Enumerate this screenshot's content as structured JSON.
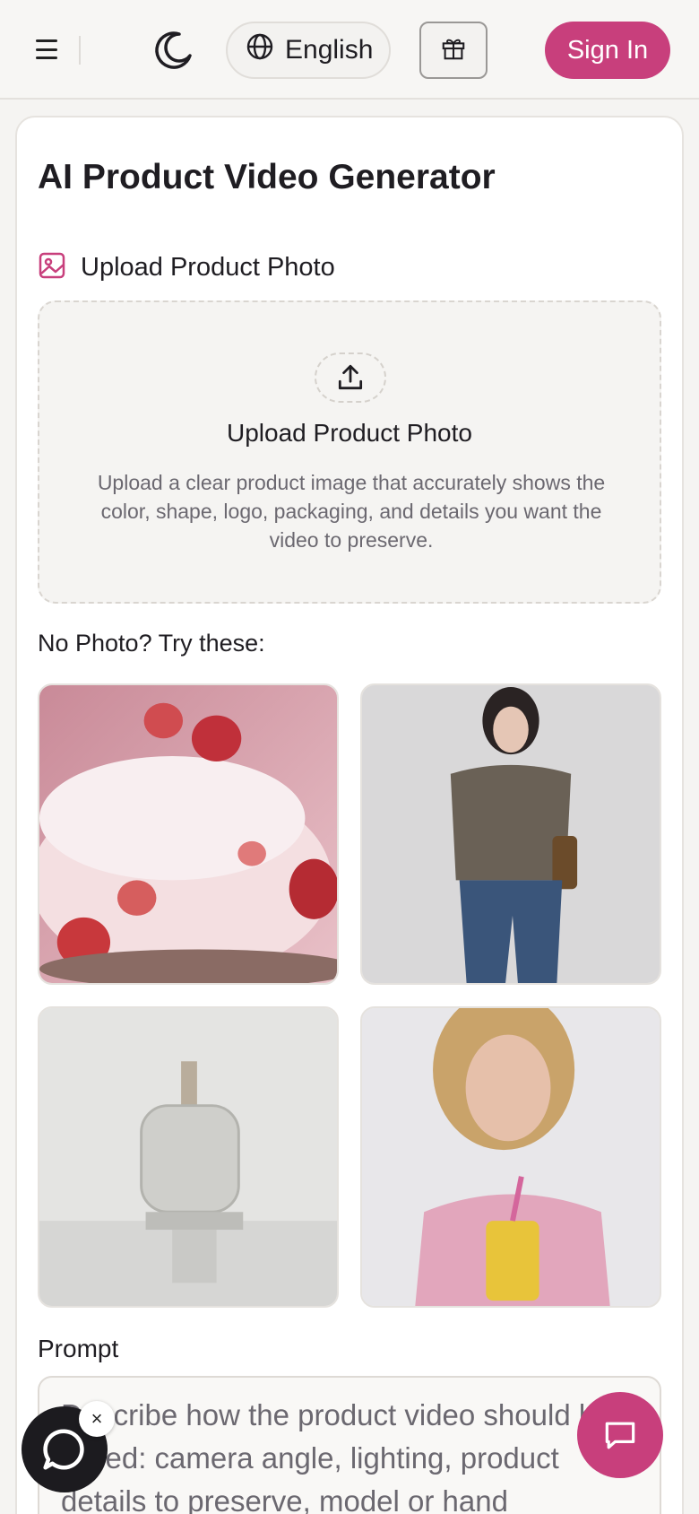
{
  "header": {
    "menu_icon": "hamburger-menu-icon",
    "theme_icon": "moon-icon",
    "language_label": "English",
    "language_icon": "globe-icon",
    "gift_icon": "gift-icon",
    "sign_in_label": "Sign In"
  },
  "main": {
    "title": "AI Product Video Generator",
    "upload_section_label": "Upload Product Photo",
    "upload_section_icon": "image-icon",
    "dropzone": {
      "icon": "upload-icon",
      "title": "Upload Product Photo",
      "description": "Upload a clear product image that accurately shows the color, shape, logo, packaging, and details you want the video to preserve."
    },
    "samples_label": "No Photo? Try these:",
    "samples": [
      {
        "name": "strawberry-cake"
      },
      {
        "name": "woman-in-blouse-and-jeans"
      },
      {
        "name": "perfume-bottle"
      },
      {
        "name": "woman-holding-drink"
      }
    ],
    "prompt_label": "Prompt",
    "prompt_placeholder": "Describe how the product video should be styled: camera angle, lighting, product details to preserve, model or hand"
  },
  "floating": {
    "chat_left_icon": "chat-bubble-icon",
    "chat_close_label": "×",
    "chat_right_icon": "message-icon"
  },
  "colors": {
    "accent": "#c83f7c",
    "background": "#f5f4f2",
    "text": "#1f1d22",
    "muted": "#6b6870"
  }
}
